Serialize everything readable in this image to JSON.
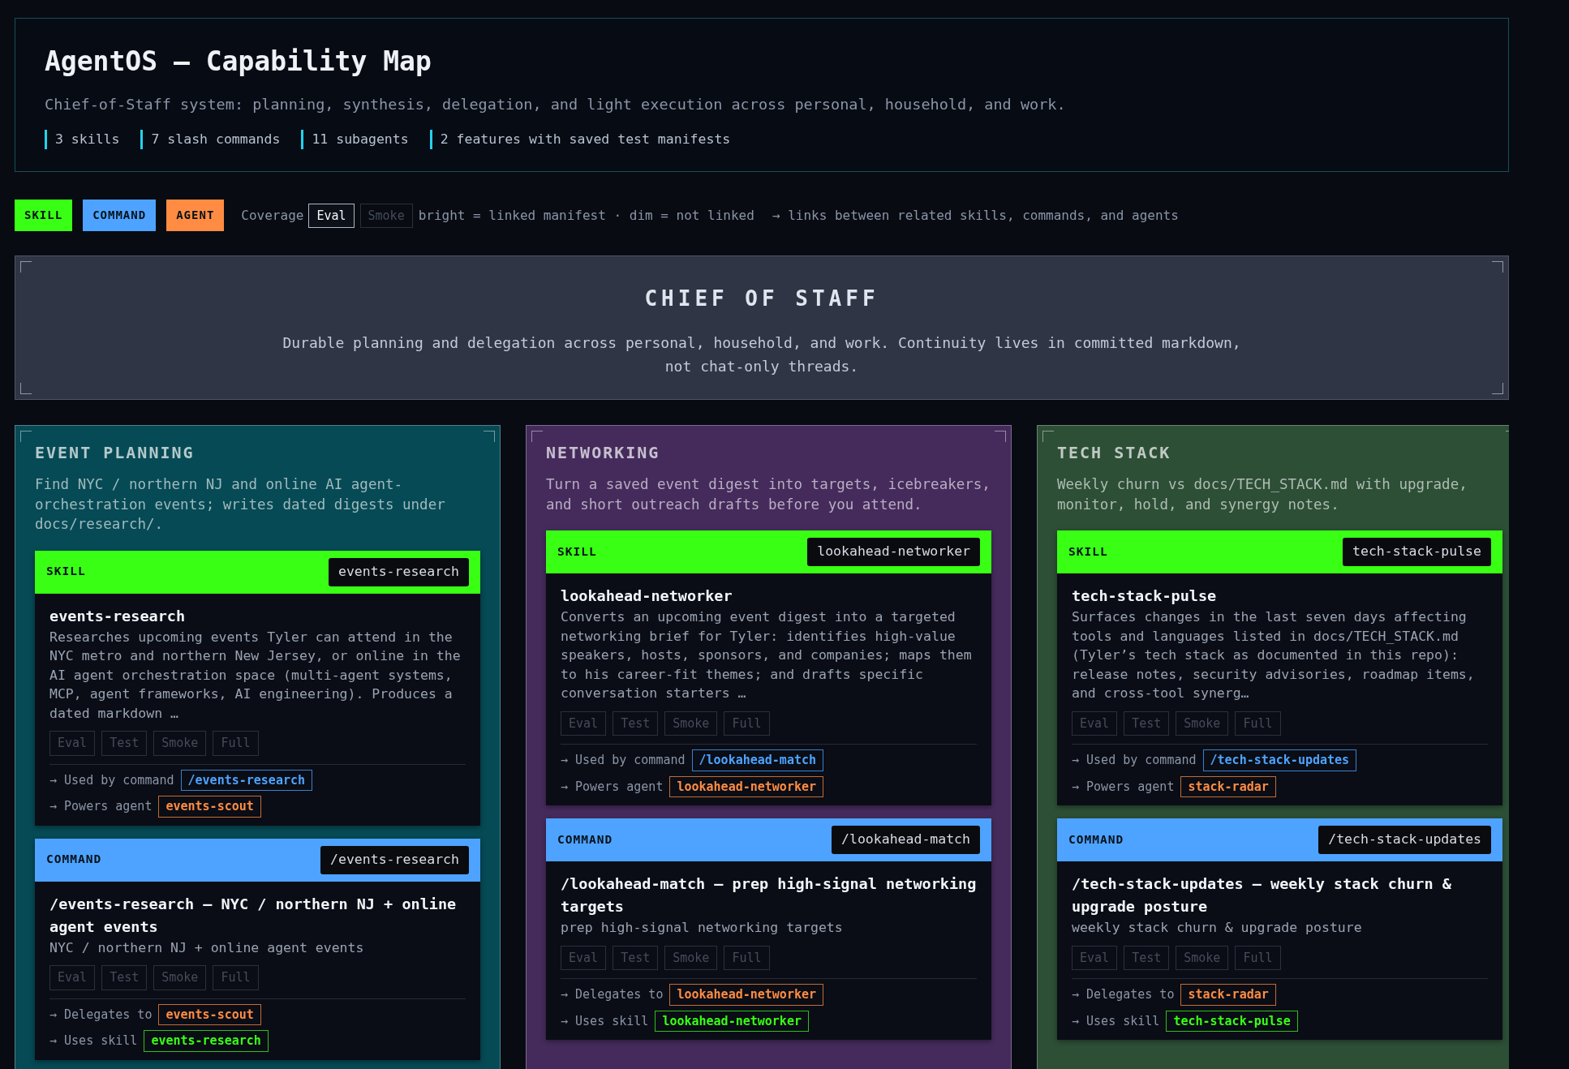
{
  "header": {
    "title": "AgentOS — Capability Map",
    "subtitle": "Chief-of-Staff system: planning, synthesis, delegation, and light execution across personal, household, and work.",
    "stats": [
      "3 skills",
      "7 slash commands",
      "11 subagents",
      "2 features with saved test manifests"
    ]
  },
  "legend": {
    "kinds": [
      {
        "label": "SKILL",
        "kind": "skill"
      },
      {
        "label": "COMMAND",
        "kind": "command"
      },
      {
        "label": "AGENT",
        "kind": "agent"
      }
    ],
    "coverage_label": "Coverage",
    "coverage_samples": [
      {
        "label": "Eval",
        "linked": true
      },
      {
        "label": "Smoke",
        "linked": false
      }
    ],
    "coverage_note": "bright = linked manifest · dim = not linked",
    "links_note": "→ links between related skills, commands, and agents"
  },
  "hero": {
    "title": "CHIEF OF STAFF",
    "text": "Durable planning and delegation across personal, household, and work. Continuity lives in committed markdown, not chat-only threads."
  },
  "columns": [
    {
      "title": "EVENT PLANNING",
      "color": "#064a55",
      "description": "Find NYC / northern NJ and online AI agent-orchestration events; writes dated digests under docs/research/.",
      "cards": [
        {
          "kind": "skill",
          "kind_label": "SKILL",
          "tag": "events-research",
          "name": "events-research",
          "description": "Researches upcoming events Tyler can attend in the NYC metro and northern New Jersey, or online in the AI agent orchestration space (multi-agent systems, MCP, agent frameworks, AI engineering). Produces a dated markdown …",
          "coverage": [
            {
              "label": "Eval",
              "linked": false
            },
            {
              "label": "Test",
              "linked": false
            },
            {
              "label": "Smoke",
              "linked": false
            },
            {
              "label": "Full",
              "linked": false
            }
          ],
          "links": [
            {
              "label": "→ Used by command",
              "target": "/events-research",
              "kind": "command"
            },
            {
              "label": "→ Powers agent",
              "target": "events-scout",
              "kind": "agent"
            }
          ]
        },
        {
          "kind": "command",
          "kind_label": "COMMAND",
          "tag": "/events-research",
          "name": "/events-research — NYC / northern NJ + online agent events",
          "description": "NYC / northern NJ + online agent events",
          "coverage": [
            {
              "label": "Eval",
              "linked": false
            },
            {
              "label": "Test",
              "linked": false
            },
            {
              "label": "Smoke",
              "linked": false
            },
            {
              "label": "Full",
              "linked": false
            }
          ],
          "links": [
            {
              "label": "→ Delegates to",
              "target": "events-scout",
              "kind": "agent"
            },
            {
              "label": "→ Uses skill",
              "target": "events-research",
              "kind": "skill"
            }
          ]
        }
      ]
    },
    {
      "title": "NETWORKING",
      "color": "#452b5c",
      "description": "Turn a saved event digest into targets, icebreakers, and short outreach drafts before you attend.",
      "cards": [
        {
          "kind": "skill",
          "kind_label": "SKILL",
          "tag": "lookahead-networker",
          "name": "lookahead-networker",
          "description": "Converts an upcoming event digest into a targeted networking brief for Tyler: identifies high-value speakers, hosts, sponsors, and companies; maps them to his career-fit themes; and drafts specific conversation starters …",
          "coverage": [
            {
              "label": "Eval",
              "linked": false
            },
            {
              "label": "Test",
              "linked": false
            },
            {
              "label": "Smoke",
              "linked": false
            },
            {
              "label": "Full",
              "linked": false
            }
          ],
          "links": [
            {
              "label": "→ Used by command",
              "target": "/lookahead-match",
              "kind": "command"
            },
            {
              "label": "→ Powers agent",
              "target": "lookahead-networker",
              "kind": "agent"
            }
          ]
        },
        {
          "kind": "command",
          "kind_label": "COMMAND",
          "tag": "/lookahead-match",
          "name": "/lookahead-match — prep high-signal networking targets",
          "description": "prep high-signal networking targets",
          "coverage": [
            {
              "label": "Eval",
              "linked": false
            },
            {
              "label": "Test",
              "linked": false
            },
            {
              "label": "Smoke",
              "linked": false
            },
            {
              "label": "Full",
              "linked": false
            }
          ],
          "links": [
            {
              "label": "→ Delegates to",
              "target": "lookahead-networker",
              "kind": "agent"
            },
            {
              "label": "→ Uses skill",
              "target": "lookahead-networker",
              "kind": "skill"
            }
          ]
        }
      ]
    },
    {
      "title": "TECH STACK",
      "color": "#2d4f36",
      "description": "Weekly churn vs docs/TECH_STACK.md with upgrade, monitor, hold, and synergy notes.",
      "cards": [
        {
          "kind": "skill",
          "kind_label": "SKILL",
          "tag": "tech-stack-pulse",
          "name": "tech-stack-pulse",
          "description": "Surfaces changes in the last seven days affecting tools and languages listed in docs/TECH_STACK.md (Tyler’s tech stack as documented in this repo): release notes, security advisories, roadmap items, and cross-tool synerg…",
          "coverage": [
            {
              "label": "Eval",
              "linked": false
            },
            {
              "label": "Test",
              "linked": false
            },
            {
              "label": "Smoke",
              "linked": false
            },
            {
              "label": "Full",
              "linked": false
            }
          ],
          "links": [
            {
              "label": "→ Used by command",
              "target": "/tech-stack-updates",
              "kind": "command"
            },
            {
              "label": "→ Powers agent",
              "target": "stack-radar",
              "kind": "agent"
            }
          ]
        },
        {
          "kind": "command",
          "kind_label": "COMMAND",
          "tag": "/tech-stack-updates",
          "name": "/tech-stack-updates — weekly stack churn & upgrade posture",
          "description": "weekly stack churn & upgrade posture",
          "coverage": [
            {
              "label": "Eval",
              "linked": false
            },
            {
              "label": "Test",
              "linked": false
            },
            {
              "label": "Smoke",
              "linked": false
            },
            {
              "label": "Full",
              "linked": false
            }
          ],
          "links": [
            {
              "label": "→ Delegates to",
              "target": "stack-radar",
              "kind": "agent"
            },
            {
              "label": "→ Uses skill",
              "target": "tech-stack-pulse",
              "kind": "skill"
            }
          ]
        }
      ]
    }
  ]
}
